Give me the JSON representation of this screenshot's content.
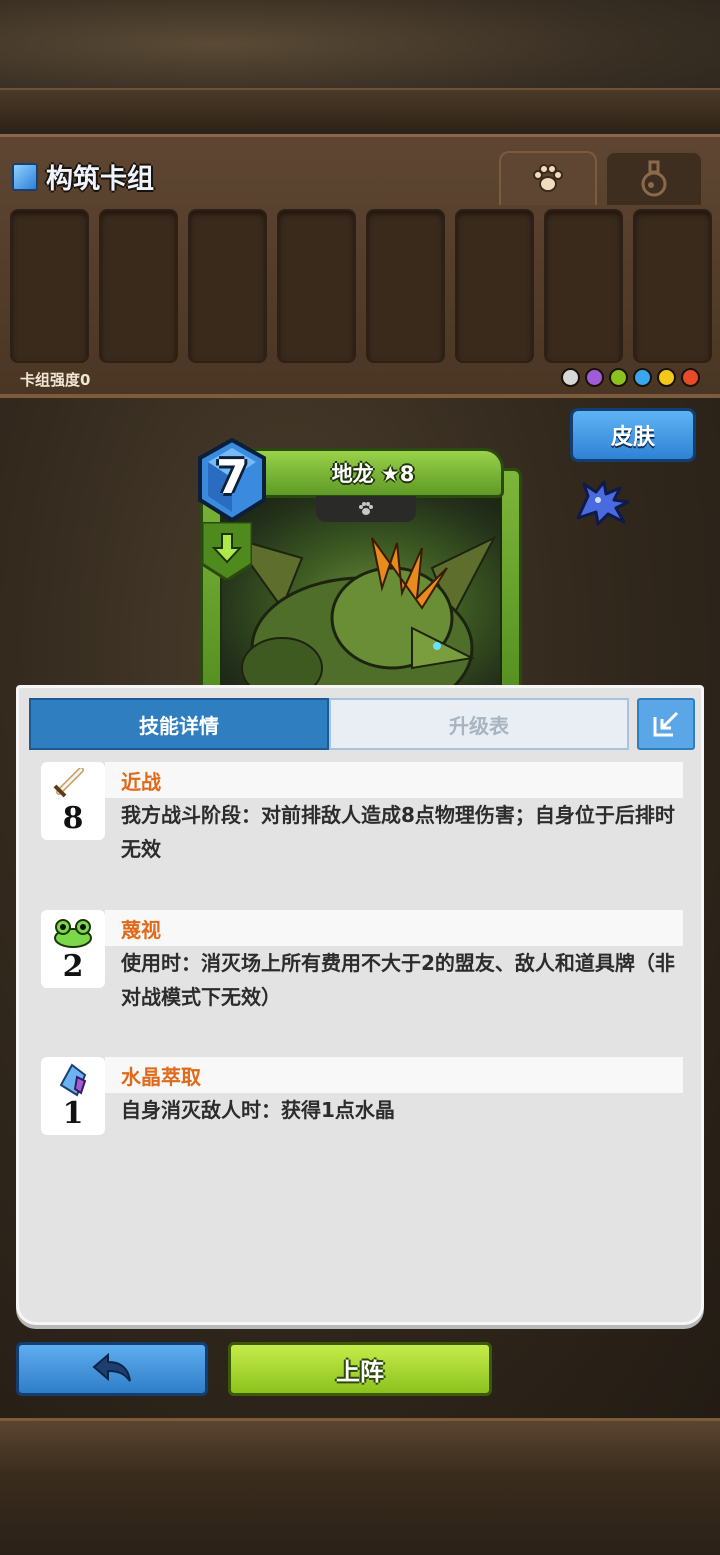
{
  "deck": {
    "title": "构筑卡组",
    "strength_label": "卡组强度0",
    "tabs": [
      {
        "icon": "paw-icon",
        "active": true
      },
      {
        "icon": "potion-icon",
        "active": false
      }
    ],
    "slot_count": 8,
    "element_colors": [
      "#d8d8d8",
      "#a05cd8",
      "#8cc21e",
      "#3aa6f0",
      "#f2c81a",
      "#e84a2a"
    ]
  },
  "skin_button": {
    "label": "皮肤"
  },
  "card": {
    "name": "地龙 ★8",
    "cost": "7",
    "type_icon": "paw-icon",
    "element_icon": "earth-arrow-icon",
    "frame_color": "#6aa82c"
  },
  "skill_panel": {
    "tabs": [
      {
        "label": "技能详情",
        "active": true
      },
      {
        "label": "升级表",
        "active": false
      }
    ],
    "skills": [
      {
        "name": "近战",
        "icon": "sword-icon",
        "value": "8",
        "description": "我方战斗阶段：对前排敌人造成8点物理伤害；自身位于后排时无效"
      },
      {
        "name": "蔑视",
        "icon": "frog-icon",
        "value": "2",
        "description": "使用时：消灭场上所有费用不大于2的盟友、敌人和道具牌（非对战模式下无效）"
      },
      {
        "name": "水晶萃取",
        "icon": "crystal-icon",
        "value": "1",
        "description": "自身消灭敌人时：获得1点水晶"
      }
    ]
  },
  "buttons": {
    "back_icon": "back-arrow-icon",
    "deploy_label": "上阵"
  }
}
